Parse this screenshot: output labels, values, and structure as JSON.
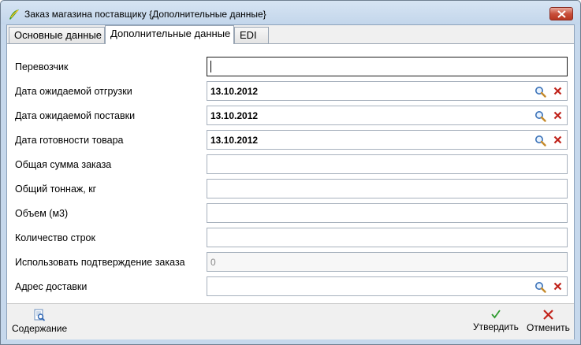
{
  "window": {
    "title": "Заказ магазина поставщику {Дополнительные данные}"
  },
  "tabs": [
    {
      "label": "Основные данные"
    },
    {
      "label": "Дополнительные данные"
    },
    {
      "label": "EDI"
    }
  ],
  "form": {
    "rows": [
      {
        "label": "Перевозчик",
        "value": ""
      },
      {
        "label": "Дата ожидаемой отгрузки",
        "value": "13.10.2012"
      },
      {
        "label": "Дата ожидаемой поставки",
        "value": "13.10.2012"
      },
      {
        "label": "Дата готовности товара",
        "value": "13.10.2012"
      },
      {
        "label": "Общая сумма заказа",
        "value": ""
      },
      {
        "label": "Общий тоннаж, кг",
        "value": ""
      },
      {
        "label": "Объем (м3)",
        "value": ""
      },
      {
        "label": "Количество строк",
        "value": ""
      },
      {
        "label": "Использовать подтверждение заказа",
        "value": "0"
      },
      {
        "label": "Адрес доставки",
        "value": ""
      }
    ]
  },
  "footer": {
    "contents_label": "Содержание",
    "approve_label": "Утвердить",
    "cancel_label": "Отменить"
  }
}
